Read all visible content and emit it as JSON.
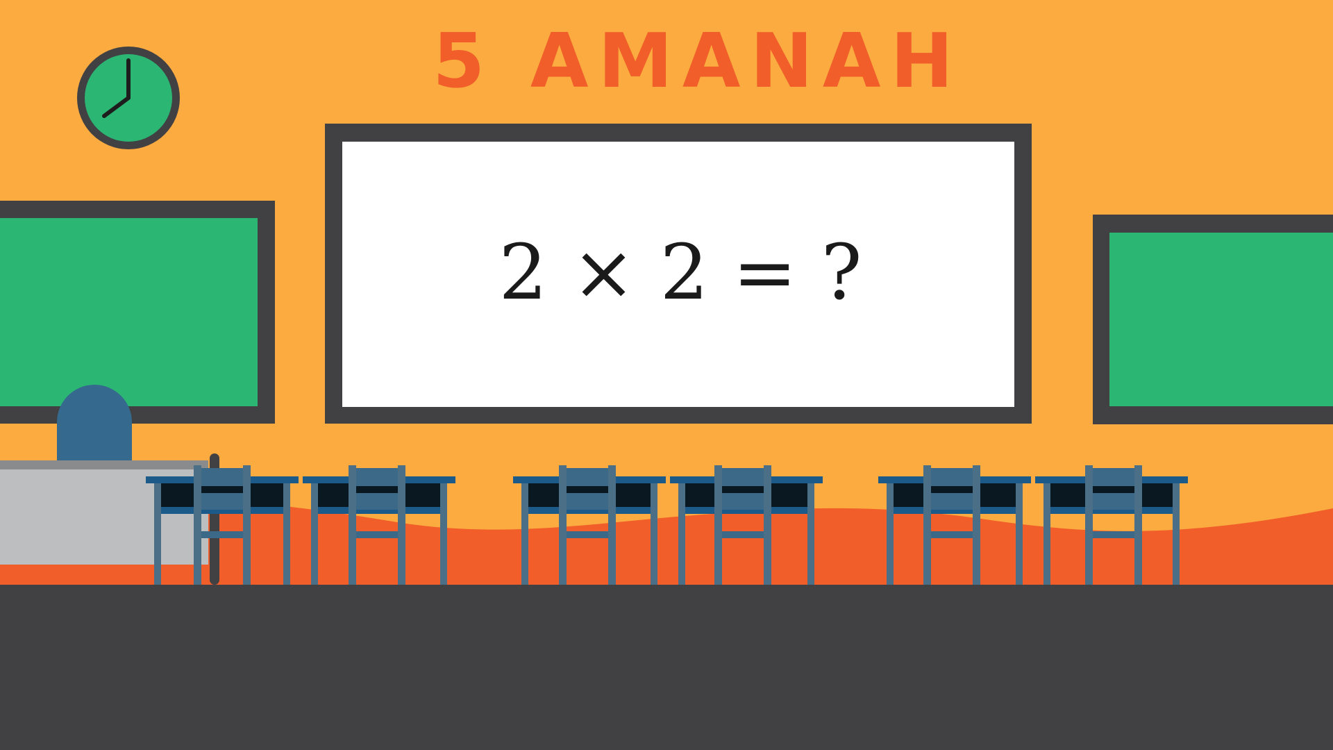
{
  "scene": {
    "class_title": "5 AMANAH",
    "whiteboard_equation": "2 × 2 = ?"
  },
  "colors": {
    "wall": "#fbab3f",
    "wave": "#f15e2a",
    "floor": "#414042",
    "frame": "#414042",
    "chalkboard": "#2bb673",
    "whiteboard": "#ffffff",
    "title": "#f15e2a",
    "clock_face": "#2bb673",
    "chair_back": "#3c6987",
    "desk_top": "#1c5a8a",
    "desk_leg": "#4b6f87",
    "desk_drawer": "#0a1822",
    "teacher_desk": "#bdbec0",
    "teacher_chair": "#356a8e"
  },
  "icons": {
    "clock": "clock-icon"
  }
}
